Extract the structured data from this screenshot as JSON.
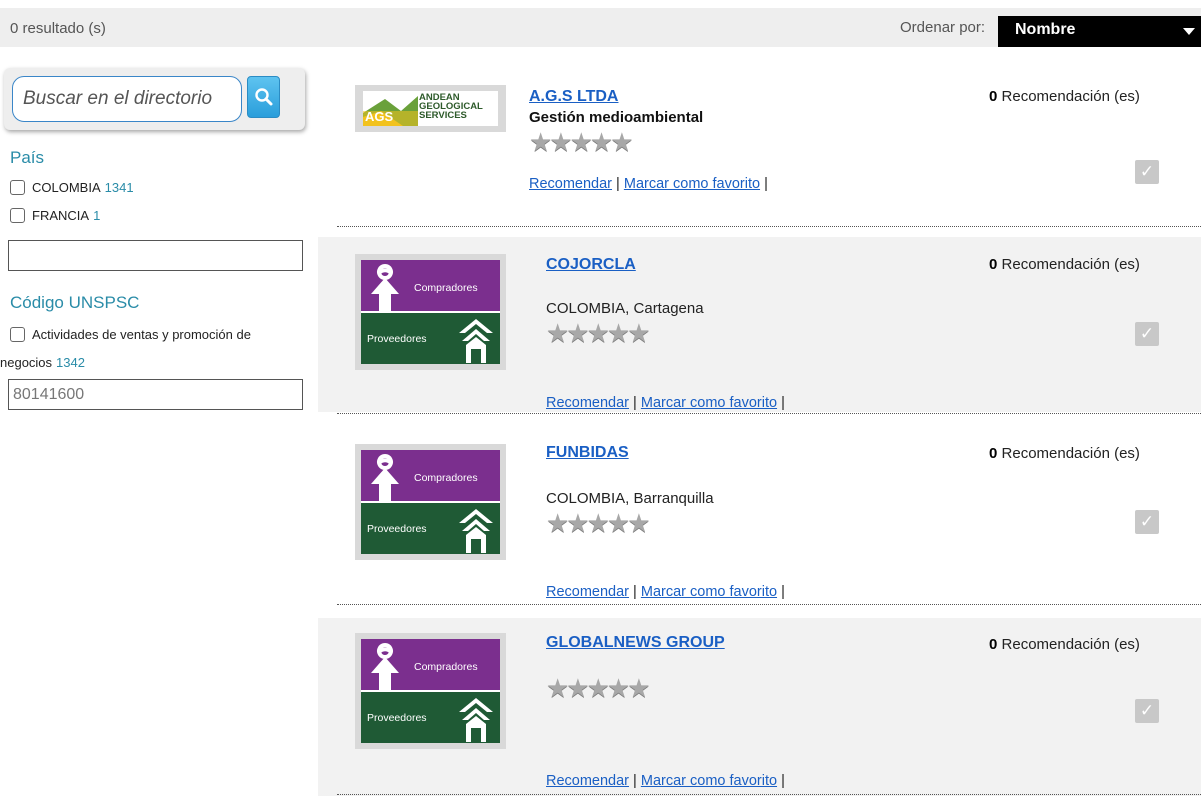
{
  "topbar": {
    "results_count": "0 resultado (s)",
    "order_label": "Ordenar por:",
    "order_value": "Nombre"
  },
  "sidebar": {
    "search_placeholder": "Buscar en el directorio",
    "country_title": "País",
    "countries": [
      {
        "label": "COLOMBIA",
        "count": "1341"
      },
      {
        "label": "FRANCIA",
        "count": "1"
      }
    ],
    "country_input_value": "",
    "unspsc_title": "Código UNSPSC",
    "unspsc_option_line1": "Actividades de ventas y promoción de",
    "unspsc_option_line2": "negocios",
    "unspsc_count": "1342",
    "unspsc_input_value": "80141600"
  },
  "results": [
    {
      "name": "A.G.S LTDA",
      "subtitle": "Gestión medioambiental",
      "location": "",
      "logo": "ags-logo",
      "logo_text": {
        "line1": "ANDEAN",
        "line2": "GEOLOGICAL",
        "line3": "SERVICES",
        "mark": "AGS"
      },
      "rating": 0,
      "recommend_count": "0",
      "recommend_label": "Recomendación (es)",
      "recommend_link": "Recomendar",
      "favorite_link": "Marcar como favorito"
    },
    {
      "name": "COJORCLA",
      "subtitle": "",
      "location": "COLOMBIA, Cartagena",
      "logo": "compradores-proveedores-logo",
      "rating": 0,
      "recommend_count": "0",
      "recommend_label": "Recomendación (es)",
      "recommend_link": "Recomendar",
      "favorite_link": "Marcar como favorito"
    },
    {
      "name": "FUNBIDAS",
      "subtitle": "",
      "location": "COLOMBIA, Barranquilla",
      "logo": "compradores-proveedores-logo",
      "rating": 0,
      "recommend_count": "0",
      "recommend_label": "Recomendación (es)",
      "recommend_link": "Recomendar",
      "favorite_link": "Marcar como favorito"
    },
    {
      "name": "GLOBALNEWS GROUP",
      "subtitle": "",
      "location": "",
      "logo": "compradores-proveedores-logo",
      "rating": 0,
      "recommend_count": "0",
      "recommend_label": "Recomendación (es)",
      "recommend_link": "Recomendar",
      "favorite_link": "Marcar como favorito"
    }
  ],
  "logo_texts": {
    "top": "Compradores",
    "bottom": "Proveedores"
  },
  "separator": "|",
  "stars_glyph": "★★★★★",
  "check_glyph": "✓",
  "colors": {
    "link": "#1a5fc4",
    "accent": "#2a8ca8",
    "logo_purple": "#7b2f8e",
    "logo_green": "#1f5a35"
  }
}
